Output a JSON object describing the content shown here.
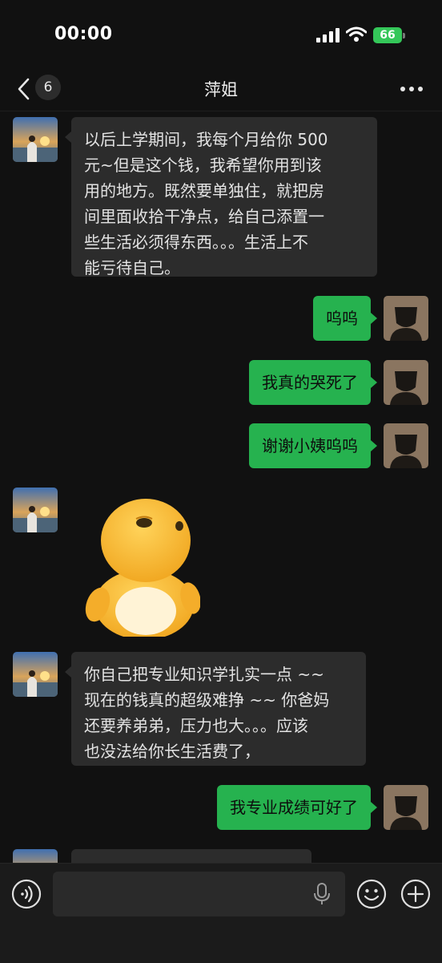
{
  "status_bar": {
    "time": "00:00",
    "battery": "66"
  },
  "nav": {
    "unread_count": "6",
    "title": "萍姐"
  },
  "messages": [
    {
      "side": "in",
      "text_lines": [
        "以后上学期间，我每个月给你 500",
        "元~但是这个钱，我希望你用到该",
        "用的地方。既然要单独住，就把房",
        "间里面收拾干净点，给自己添置一",
        "些生活必须得东西。。。生活上不",
        "能亏待自己。"
      ]
    },
    {
      "side": "out",
      "text": "呜呜"
    },
    {
      "side": "out",
      "text": "我真的哭死了"
    },
    {
      "side": "out",
      "text": "谢谢小姨呜呜"
    },
    {
      "side": "in",
      "type": "sticker",
      "sticker": "yellow-dinosaur-sticker"
    },
    {
      "side": "in",
      "text_lines": [
        "你自己把专业知识学扎实一点 ~~",
        "现在的钱真的超级难挣 ~~ 你爸妈",
        "还要养弟弟，压力也大。。。应该",
        "也没法给你长生活费了，"
      ]
    },
    {
      "side": "out",
      "text": "我专业成绩可好了"
    }
  ],
  "colors": {
    "outgoing_bubble": "#26b24f",
    "incoming_bubble": "#2c2c2c",
    "background": "#111111"
  },
  "icons": [
    "back-icon",
    "more-icon",
    "voice-icon",
    "mic-icon",
    "emoji-icon",
    "plus-icon"
  ]
}
